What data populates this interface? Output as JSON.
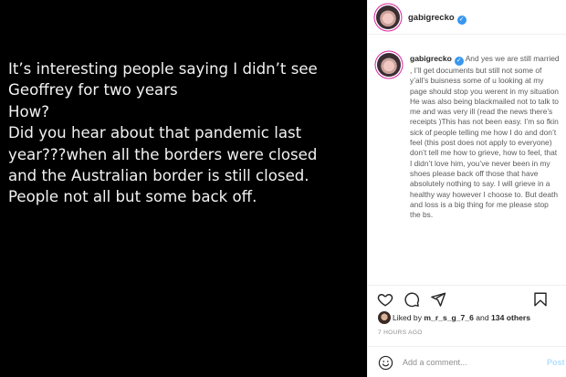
{
  "post_image": {
    "text": "It’s interesting people saying I didn’t see\nGeoffrey for two years\nHow?\nDid you hear about that pandemic last\nyear???when all the borders were closed\nand the Australian border is still closed.\nPeople not all but some back off."
  },
  "header": {
    "username": "gabigrecko",
    "verified_mark": "✓"
  },
  "caption": {
    "username": "gabigrecko",
    "text": " And yes we are still married , I’ll get documents but still not some of y’all’s buisness some of u looking at my page should stop you werent in my situation\nHe was also being blackmailed not to talk to me and was very ill (read the news there’s receipts )This has not been easy. I’m so fkin sick of people telling me how I do and don’t feel (this post does not apply to everyone) don’t tell me how to grieve, how to feel, that I didn’t love him, you’ve never been in my shoes please back off those that have absolutely nothing to say. I will grieve in a healthy way however I choose to. But death and loss is a big thing for me please stop the bs."
  },
  "actions": {
    "icons": [
      "heart-icon",
      "comment-icon",
      "share-icon",
      "save-icon"
    ]
  },
  "likes": {
    "prefix": "Liked by ",
    "user": "m_r_s_g_7_6",
    "middle": " and ",
    "others": "134 others"
  },
  "timestamp": "7 HOURS AGO",
  "comment": {
    "placeholder": "Add a comment...",
    "post_label": "Post"
  },
  "colors": {
    "image_bg": "#000000",
    "verified": "#3897f0",
    "post_button_disabled": "#b2dffc"
  }
}
